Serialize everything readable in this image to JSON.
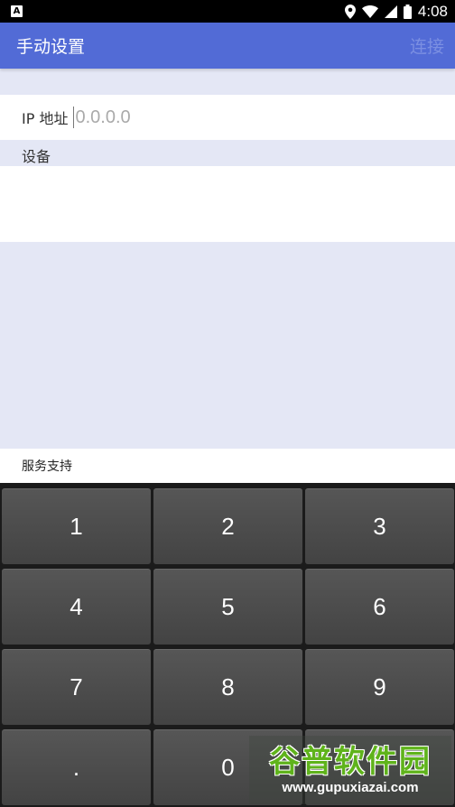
{
  "status_bar": {
    "notification_letter": "A",
    "time": "4:08",
    "icons": [
      "location-icon",
      "wifi-icon",
      "cell-signal-icon",
      "battery-icon"
    ]
  },
  "app_bar": {
    "title": "手动设置",
    "connect_label": "连接"
  },
  "ip_field": {
    "label": "IP 地址",
    "placeholder": "0.0.0.0",
    "value": ""
  },
  "device_section": {
    "header": "设备"
  },
  "service": {
    "label": "服务支持"
  },
  "keypad": {
    "keys": [
      "1",
      "2",
      "3",
      "4",
      "5",
      "6",
      "7",
      "8",
      "9",
      ".",
      "0",
      ""
    ]
  },
  "watermark": {
    "logo_text": "谷普软件园",
    "url": "www.gupuxiazai.com"
  },
  "colors": {
    "app_bar": "#526bd6",
    "background": "#e4e7f5",
    "keypad_bg": "#1b1b1b",
    "key_bg": "#4b4b4b"
  }
}
